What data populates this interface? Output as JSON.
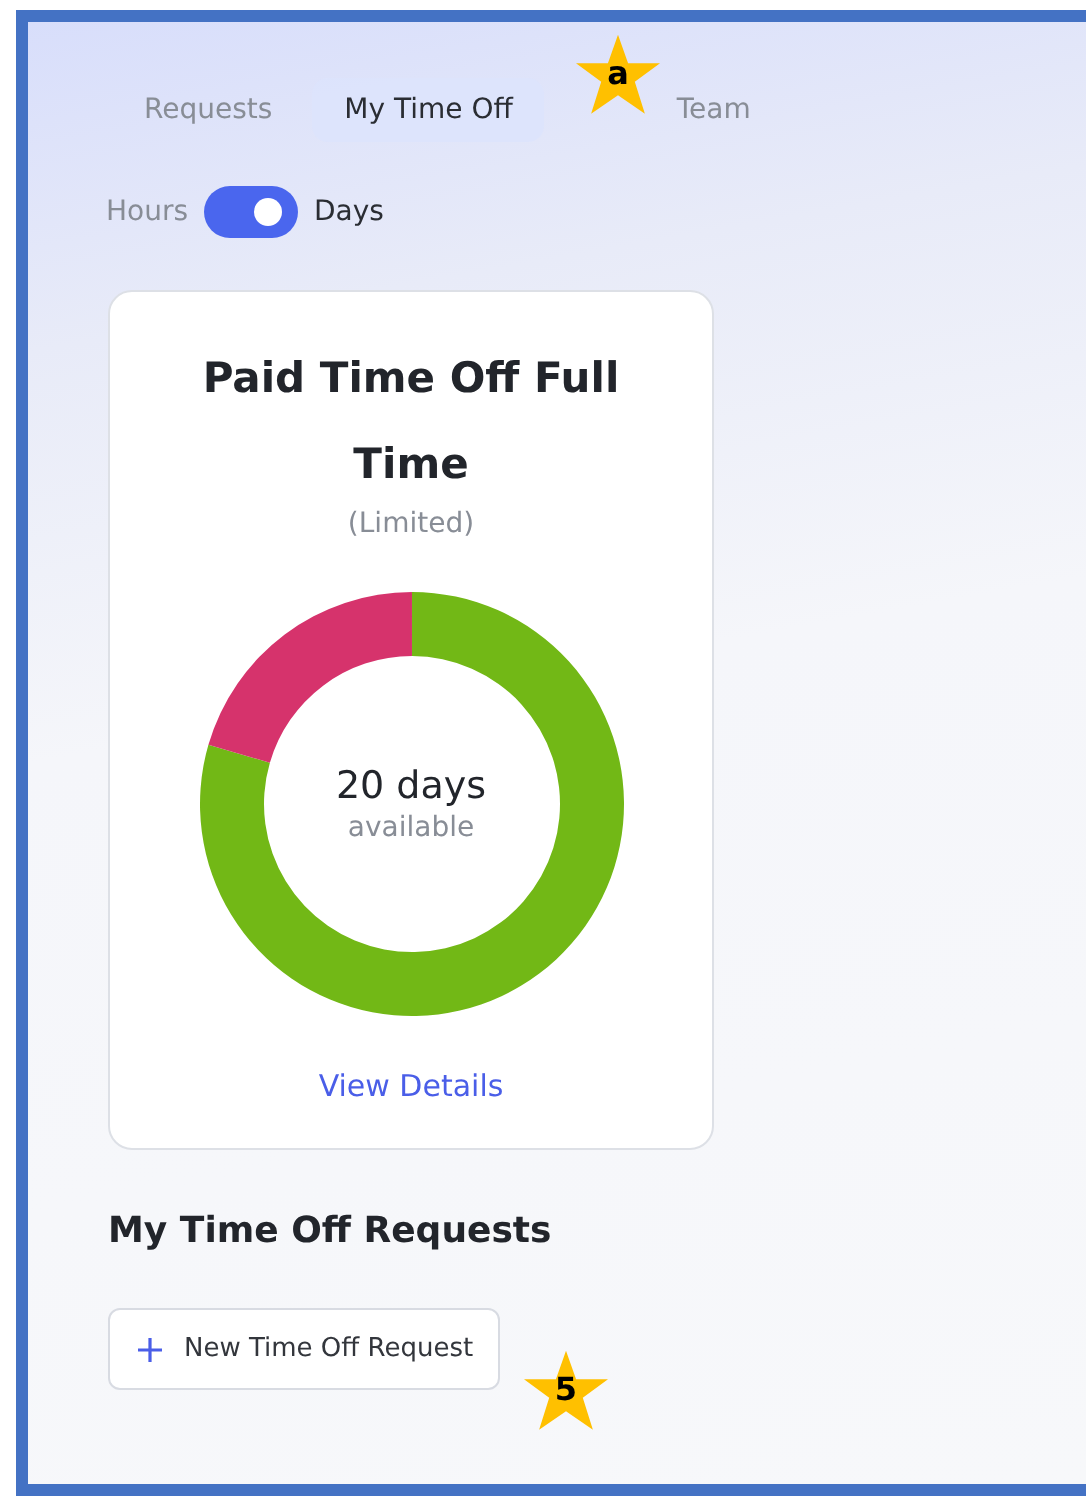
{
  "tabs": [
    {
      "label": "Requests",
      "selected": false
    },
    {
      "label": "My Time Off",
      "selected": true
    },
    {
      "label": "Team",
      "selected": false
    }
  ],
  "unit_toggle": {
    "left_label": "Hours",
    "right_label": "Days",
    "on": true
  },
  "balance_card": {
    "title": "Paid Time Off Full Time",
    "subtitle": "(Limited)",
    "amount": "20 days",
    "amount_caption": "available",
    "link": "View Details"
  },
  "section": {
    "heading": "My Time Off Requests",
    "button": "New Time Off Request"
  },
  "callouts": [
    {
      "label": "a"
    },
    {
      "label": "5"
    }
  ]
}
